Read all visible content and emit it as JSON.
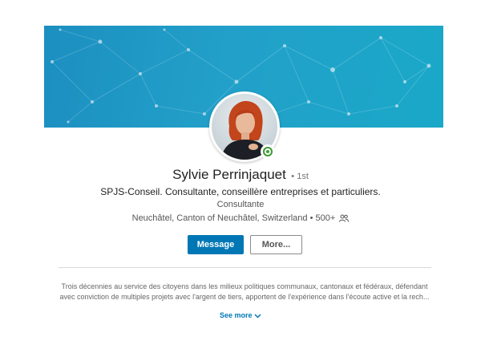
{
  "banner": {
    "pattern": "network-nodes",
    "color": "#1e9ac6"
  },
  "profile": {
    "name": "Sylvie Perrinjaquet",
    "degree": "• 1st",
    "headline": "SPJS-Conseil. Consultante, conseillère entreprises et particuliers.",
    "role": "Consultante",
    "location": "Neuchâtel, Canton of Neuchâtel, Switzerland",
    "connections": "500+",
    "status_color": "#3f9c35"
  },
  "actions": {
    "message_label": "Message",
    "more_label": "More..."
  },
  "summary": {
    "line1": "Trois décennies au service des citoyens dans les milieux politiques communaux, cantonaux et fédéraux, défendant",
    "line2": "avec conviction de multiples projets avec l'argent de tiers, apportent de l'expérience dans l'écoute active et la rech..."
  },
  "see_more_label": "See more",
  "colors": {
    "accent": "#0077b5",
    "online": "#3f9c35"
  }
}
